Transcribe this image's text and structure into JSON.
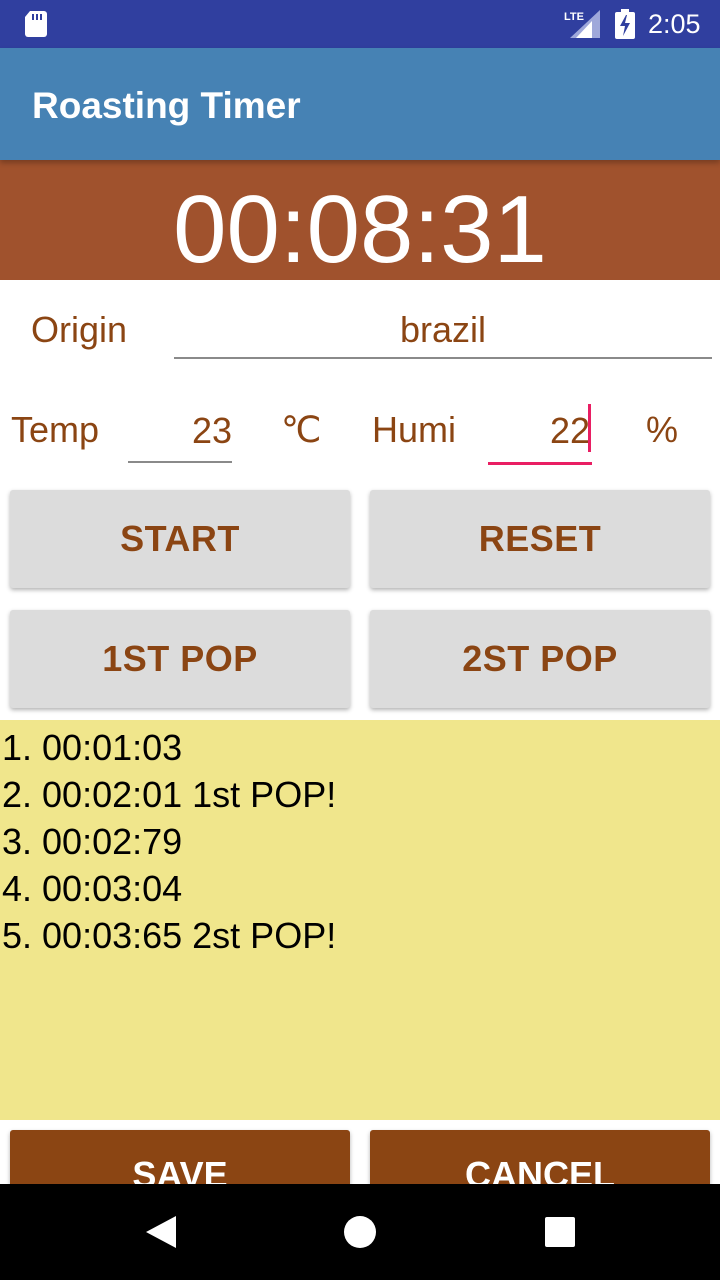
{
  "status_bar": {
    "time": "2:05",
    "network": "LTE",
    "icons": [
      "sd-card-icon",
      "lte-signal-icon",
      "battery-charging-icon"
    ],
    "color": "#303F9F"
  },
  "app_bar": {
    "title": "Roasting Timer",
    "color": "#4682B4"
  },
  "timer": {
    "value": "00:08:31",
    "background": "#A0522D"
  },
  "form": {
    "origin_label": "Origin",
    "origin_value": "brazil",
    "temp_label": "Temp",
    "temp_value": "23",
    "temp_unit": "℃",
    "humi_label": "Humi",
    "humi_value": "22",
    "humi_unit": "%",
    "text_color": "#8B4513",
    "focus_color": "#E91E63"
  },
  "buttons": {
    "start": "START",
    "reset": "RESET",
    "first_pop": "1ST POP",
    "second_pop": "2ST POP",
    "save": "SAVE",
    "cancel": "CANCEL"
  },
  "log": {
    "background": "#F0E68C",
    "entries": [
      "1. 00:01:03",
      "2. 00:02:01 1st POP!",
      "3. 00:02:79",
      "4. 00:03:04",
      "5. 00:03:65 2st POP!"
    ]
  },
  "nav_bar": {
    "icons": [
      "back-icon",
      "home-icon",
      "recents-icon"
    ]
  }
}
